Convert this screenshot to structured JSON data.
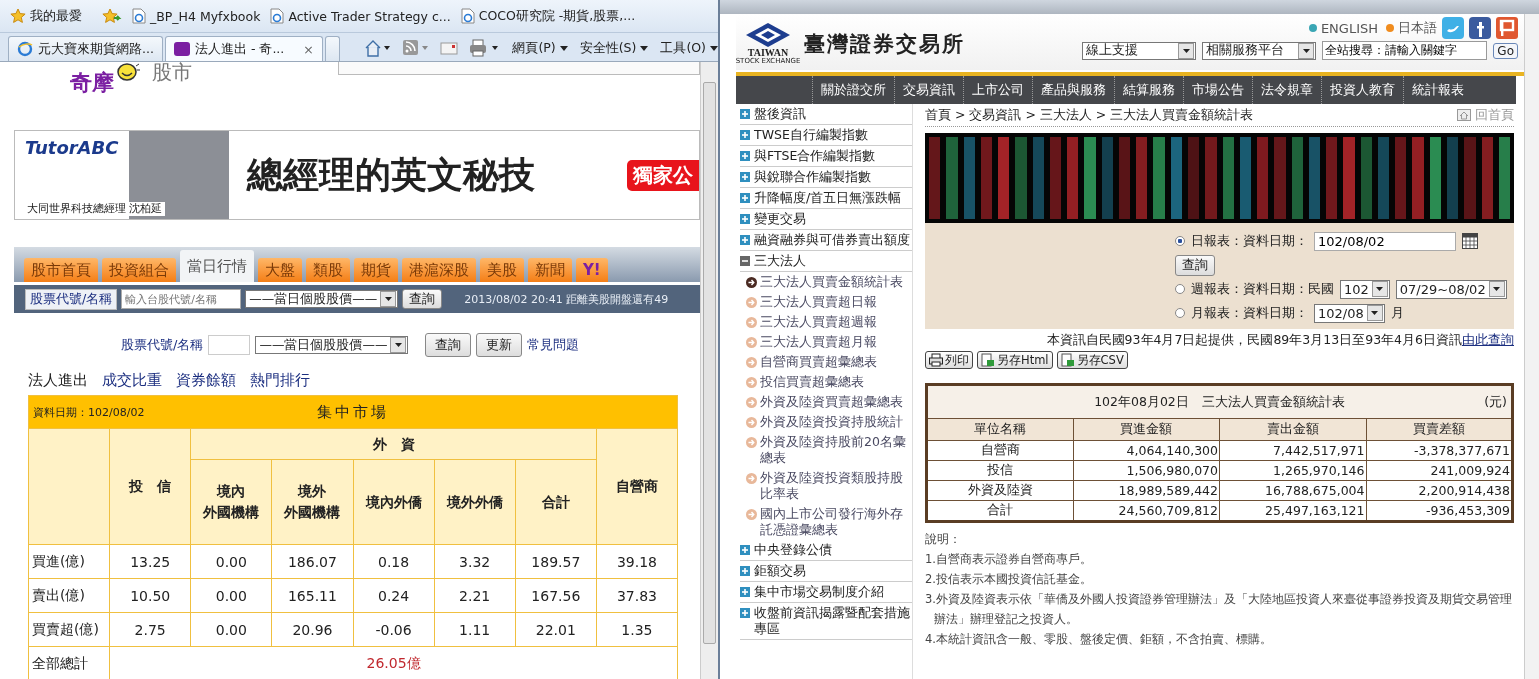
{
  "left_browser": {
    "favorites_bar": {
      "label": "我的最愛",
      "links": [
        "_BP_H4  Myfxbook",
        "Active Trader Strategy c...",
        "COCO研究院 -期貨,股票,..."
      ]
    },
    "tabs": [
      {
        "label": "元大寶來期貨網路...",
        "selected": false
      },
      {
        "label": "法人進出 - 奇...",
        "selected": true
      }
    ],
    "tab_close": "×",
    "command_bar": [
      "網頁(P)",
      "安全性(S)",
      "工具(O)"
    ],
    "page": {
      "logo": {
        "name": "奇摩",
        "suffix": "股市"
      },
      "ad": {
        "brand": "TutorABC",
        "caption": "大同世界科技總經理  沈柏延",
        "headline": "總經理的英文秘技",
        "button": "獨家公"
      },
      "nav_tabs": [
        {
          "label": "股市首頁",
          "selected": false
        },
        {
          "label": "投資組合",
          "selected": false
        },
        {
          "label": "當日行情",
          "selected": true
        },
        {
          "label": "大盤",
          "selected": false
        },
        {
          "label": "類股",
          "selected": false
        },
        {
          "label": "期貨",
          "selected": false
        },
        {
          "label": "港滬深股",
          "selected": false
        },
        {
          "label": "美股",
          "selected": false
        },
        {
          "label": "新聞",
          "selected": false
        },
        {
          "label": "Y!",
          "selected": false
        }
      ],
      "quote_bar": {
        "label_button": "股票代號/名稱",
        "placeholder": "輸入台股代號/名稱",
        "select": "——當日個股股價——",
        "button": "查詢",
        "status": "2013/08/02 20:41 距離美股開盤還有49"
      },
      "query_row": {
        "label": "股票代號/名稱",
        "select": "——當日個股股價——",
        "buttons": [
          "查詢",
          "更新"
        ],
        "link": "常見問題"
      },
      "sub_nav": [
        {
          "label": "法人進出",
          "selected": true
        },
        {
          "label": "成交比重",
          "selected": false
        },
        {
          "label": "資券餘額",
          "selected": false
        },
        {
          "label": "熱門排行",
          "selected": false
        }
      ],
      "institutional_table": {
        "date": "資料日期：102/08/02",
        "title": "集中市場",
        "trust": "投　信",
        "foreign": "外　資",
        "foreign_columns": [
          [
            "境內",
            "外國機構"
          ],
          [
            "境外",
            "外國機構"
          ],
          [
            "境內外僑"
          ],
          [
            "境外外僑"
          ],
          [
            "合計"
          ]
        ],
        "dealer": "自營商",
        "rows": [
          {
            "label": "買進(億)",
            "values": [
              "13.25",
              "0.00",
              "186.07",
              "0.18",
              "3.32",
              "189.57",
              "39.18"
            ]
          },
          {
            "label": "賣出(億)",
            "values": [
              "10.50",
              "0.00",
              "165.11",
              "0.24",
              "2.21",
              "167.56",
              "37.83"
            ]
          },
          {
            "label": "買賣超(億)",
            "values": [
              "2.75",
              "0.00",
              "20.96",
              "-0.06",
              "1.11",
              "22.01",
              "1.35"
            ]
          }
        ],
        "total": {
          "label": "全部總計",
          "value": "26.05億"
        }
      }
    }
  },
  "right_page": {
    "header": {
      "logo_name": "TAIWAN",
      "logo_sub": "STOCK EXCHANGE",
      "title": "臺灣證券交易所",
      "languages": [
        {
          "label": "ENGLISH",
          "color": "#3aa6b4"
        },
        {
          "label": "日本語",
          "color": "#f08c1e"
        }
      ],
      "selects": [
        "線上支援",
        "相關服務平台"
      ],
      "search_value": "全站搜尋：請輸入關鍵字",
      "go": "Go"
    },
    "nav": [
      "關於證交所",
      "交易資訊",
      "上市公司",
      "產品與服務",
      "結算服務",
      "市場公告",
      "法令規章",
      "投資人教育",
      "統計報表"
    ],
    "sidebar": [
      {
        "label": "盤後資訊",
        "expanded": false
      },
      {
        "label": "TWSE自行編製指數",
        "expanded": false
      },
      {
        "label": "與FTSE合作編製指數",
        "expanded": false
      },
      {
        "label": "與銳聯合作編製指數",
        "expanded": false
      },
      {
        "label": "升降幅度/首五日無漲跌幅",
        "expanded": false
      },
      {
        "label": "變更交易",
        "expanded": false
      },
      {
        "label": "融資融券與可借券賣出額度",
        "expanded": false
      },
      {
        "label": "三大法人",
        "expanded": true,
        "children": [
          {
            "label": "三大法人買賣金額統計表",
            "selected": true
          },
          {
            "label": "三大法人買賣超日報",
            "selected": false
          },
          {
            "label": "三大法人買賣超週報",
            "selected": false
          },
          {
            "label": "三大法人買賣超月報",
            "selected": false
          },
          {
            "label": "自營商買賣超彙總表",
            "selected": false
          },
          {
            "label": "投信買賣超彙總表",
            "selected": false
          },
          {
            "label": "外資及陸資買賣超彙總表",
            "selected": false
          },
          {
            "label": "外資及陸資投資持股統計",
            "selected": false
          },
          {
            "label": "外資及陸資持股前20名彙總表",
            "selected": false
          },
          {
            "label": "外資及陸資投資類股持股比率表",
            "selected": false
          },
          {
            "label": "國內上市公司發行海外存託憑證彙總表",
            "selected": false
          }
        ]
      },
      {
        "label": "中央登錄公債",
        "expanded": false
      },
      {
        "label": "鉅額交易",
        "expanded": false
      },
      {
        "label": "集中市場交易制度介紹",
        "expanded": false
      },
      {
        "label": "收盤前資訊揭露暨配套措施專區",
        "expanded": false
      }
    ],
    "breadcrumb": "首頁 > 交易資訊 > 三大法人 > 三大法人買賣金額統計表",
    "home_link": "回首頁",
    "report_form": {
      "options": [
        {
          "kind": "daily",
          "label": "日報表：資料日期：",
          "selected": true,
          "value": "102/08/02",
          "button": "查詢"
        },
        {
          "kind": "weekly",
          "label": "週報表：資料日期：民國",
          "selected": false,
          "year": "102",
          "range": "07/29~08/02"
        },
        {
          "kind": "monthly",
          "label": "月報表：資料日期：",
          "selected": false,
          "month": "102/08",
          "suffix": "月"
        }
      ]
    },
    "notice": {
      "text": "本資訊自民國93年4月7日起提供，民國89年3月13日至93年4月6日資訊",
      "link": "由此查詢"
    },
    "export_buttons": [
      {
        "kind": "print",
        "label": "列印"
      },
      {
        "kind": "html",
        "label": "另存Html"
      },
      {
        "kind": "csv",
        "label": "另存CSV"
      }
    ],
    "summary_table": {
      "title": "102年08月02日　三大法人買賣金額統計表",
      "unit": "(元)",
      "columns": [
        "單位名稱",
        "買進金額",
        "賣出金額",
        "買賣差額"
      ],
      "rows": [
        [
          "自營商",
          "4,064,140,300",
          "7,442,517,971",
          "-3,378,377,671"
        ],
        [
          "投信",
          "1,506,980,070",
          "1,265,970,146",
          "241,009,924"
        ],
        [
          "外資及陸資",
          "18,989,589,442",
          "16,788,675,004",
          "2,200,914,438"
        ],
        [
          "合計",
          "24,560,709,812",
          "25,497,163,121",
          "-936,453,309"
        ]
      ]
    },
    "notes": {
      "title": "說明：",
      "items": [
        "1.自營商表示證券自營商專戶。",
        "2.投信表示本國投資信託基金。",
        "3.外資及陸資表示依「華僑及外國人投資證券管理辦法」及「大陸地區投資人來臺從事證券投資及期貨交易管理辦法」辦理登記之投資人。",
        "4.本統計資訊含一般、零股、盤後定價、鉅額，不含拍賣、標購。"
      ]
    }
  }
}
